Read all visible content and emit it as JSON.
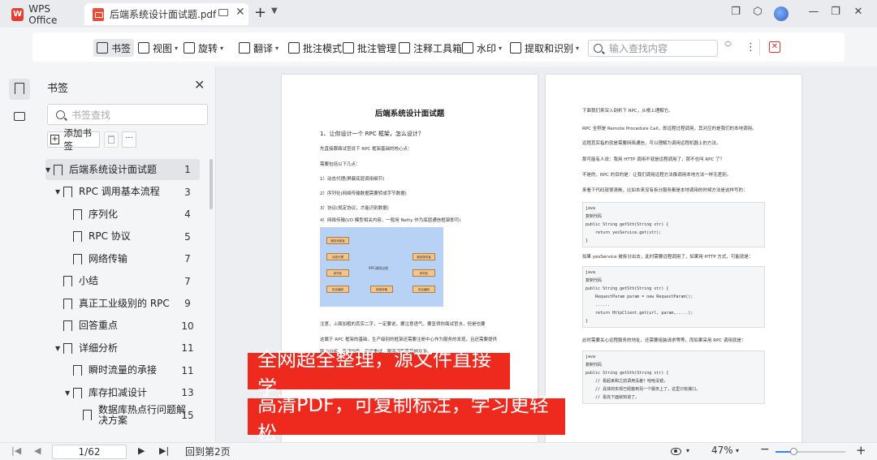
{
  "tabs": {
    "home": "WPS Office",
    "doc": "后端系统设计面试题.pdf"
  },
  "toolbar": {
    "bookmark": "书签",
    "view": "视图",
    "rotate": "旋转",
    "translate": "翻译",
    "annotate_mode": "批注模式",
    "annotate_manage": "批注管理",
    "note_tools": "注释工具箱",
    "watermark": "水印",
    "extract": "提取和识别",
    "search_placeholder": "输入查找内容"
  },
  "panel": {
    "title": "书签",
    "search_placeholder": "书签查找",
    "add_label": "添加书签",
    "items": [
      {
        "label": "后端系统设计面试题",
        "page": "1",
        "level": 0,
        "expanded": true,
        "selected": true
      },
      {
        "label": "RPC 调用基本流程",
        "page": "3",
        "level": 1,
        "expanded": true
      },
      {
        "label": "序列化",
        "page": "4",
        "level": 2
      },
      {
        "label": "RPC 协议",
        "page": "5",
        "level": 2
      },
      {
        "label": "网络传输",
        "page": "7",
        "level": 2
      },
      {
        "label": "小结",
        "page": "7",
        "level": 1
      },
      {
        "label": "真正工业级别的 RPC",
        "page": "9",
        "level": 1
      },
      {
        "label": "回答重点",
        "page": "10",
        "level": 1
      },
      {
        "label": "详细分析",
        "page": "11",
        "level": 1,
        "expanded": true
      },
      {
        "label": "瞬时流量的承接",
        "page": "11",
        "level": 2
      },
      {
        "label": "库存扣减设计",
        "page": "13",
        "level": 2,
        "expanded": true
      },
      {
        "label": "数据库热点行问题解决方案",
        "page": "15",
        "level": 3
      }
    ]
  },
  "page1": {
    "title": "后端系统设计面试题",
    "q1": "1、让你设计一个 RPC 框架，怎么设计？",
    "lines": [
      "先直接跟面试官说下 RPC 框架基础的核心点：",
      "需要包括以下几点：",
      "1）动态代理(屏蔽底层调用细节)",
      "2）序列化(网络传输数据需要转成字节数据)",
      "3）协议(规定协议，才能识别数据)",
      "4）网络传输(I/O 模型相关内容，一般用 Netty 作为底层通信框架即可)",
      "注意，上面加粗的其实二字，一定要说，要注意语气，要显得你面试官水，但是也要",
      "这属于 RPC 框架的基础，生产级别的框架还需要注册中心作为服务的发现，且还需要提供",
      "路由分组、负载均衡、异常重试、限流熔断等其他功能。"
    ],
    "diagram": [
      "服务消费者",
      "动态代理",
      "序列化",
      "协议编码",
      "网络传输",
      "RPC调用过程",
      "服务提供者"
    ]
  },
  "page2": {
    "lines": [
      "下面我们来深入剖析下 RPC，从根上理解它。",
      "RPC 全称是 Remote Procedure Call，即远程过程调用，其对应的是我们的本地调用。",
      "远程其实指的就是需要网络通信，可以理解为调用远程机器上的方法。",
      "那可能有人说：我用 HTTP 调用不就是远程调用了，那不也叫 RPC 了？",
      "不是的，RPC 的目的是：让我们调用远程方法像调用本地方法一样无差别。",
      "来看下代码就很清晰，比如本来没有拆分服务都是本地调用的时候方法是这样写的："
    ],
    "code1": [
      "java",
      "复制代码",
      "public String getSth(String str) {",
      "    return yesService.get(str);",
      "}"
    ],
    "mid": "如果 yesService 被拆分出去，此时需要远程调用了，如果用 HTTP 方式，可能就是：",
    "code2": [
      "java",
      "复制代码",
      "public String getSth(String str) {",
      "    RequestParam param = new RequestParam();",
      "    ......",
      "    return HttpClient.get(url, param,.....);",
      "}"
    ],
    "mid2": "此时需要关心远程服务的地址，还需要组装请求等等，而如果采用 RPC 调用就是：",
    "code3": [
      "java",
      "复制代码",
      "public String getSth(String str) {",
      "    // 看起来和之前调用没差？哈哈没错，",
      "    // 具体的实现已经搬到另一个服务上了，这里只有接口。",
      "    // 看完下面就知道了。"
    ]
  },
  "banners": [
    "全网超全整理，源文件直接学",
    "高清PDF，可复制标注，学习更轻松"
  ],
  "status": {
    "page_box": "1/62",
    "back": "回到第2页",
    "zoom": "47%",
    "zoom_fraction": 0.25
  }
}
